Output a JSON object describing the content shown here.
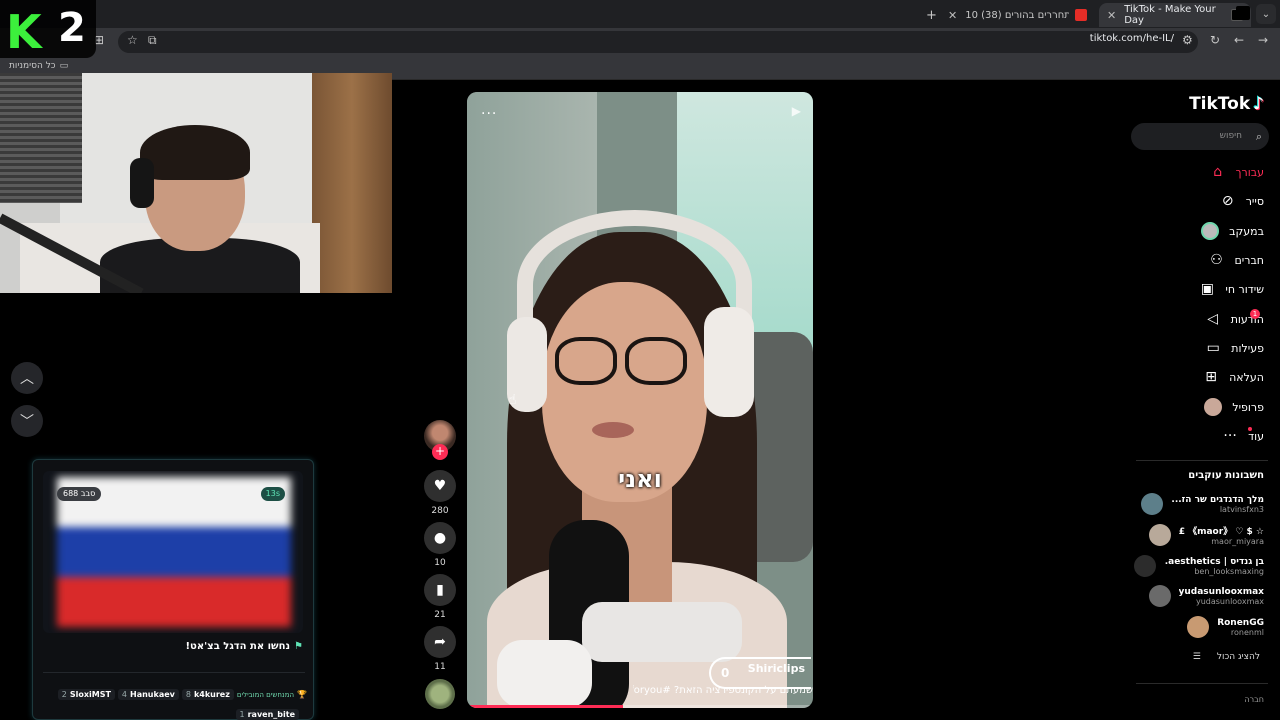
{
  "browser": {
    "tabs": [
      {
        "title": "TikTok - Make Your Day",
        "active": true
      },
      {
        "title": "10 (38) ילדים מתחררים בהורים",
        "active": false
      }
    ],
    "new_tab": "+",
    "url": "tiktok.com/he-IL/",
    "bookmarks_label": "כל הסימניות"
  },
  "overlay": {
    "logo_k": "K",
    "logo_2": "2"
  },
  "flag_widget": {
    "round_label": "סבב 688",
    "timer": "13s",
    "flag_colors": [
      "#f2f2f2",
      "#1d3fa8",
      "#d92a2a"
    ],
    "prompt": "נחשו את הדגל בצ'אט!",
    "top_label": "המנחשים המובילים",
    "top_guessers": [
      {
        "name": "k4kurez",
        "count": "8"
      },
      {
        "name": "Hanukaev",
        "count": "4"
      },
      {
        "name": "SloxiMST",
        "count": "2"
      }
    ],
    "extra_guesser": {
      "name": "raven_bite",
      "count": "1"
    }
  },
  "video": {
    "menu": "...",
    "caption": "ואני",
    "author": "Shiriclips",
    "counter": "0",
    "description": "שמעתם על הקונספירציה הזאת? #foryou",
    "progress": 0.45
  },
  "actions": {
    "likes": "280",
    "comments": "10",
    "saves": "21",
    "shares": "11"
  },
  "sidebar": {
    "brand": "TikTok",
    "search_placeholder": "חיפוש",
    "nav": [
      {
        "label": "עבורך",
        "icon": "home-icon",
        "active": true
      },
      {
        "label": "סייר",
        "icon": "compass-icon"
      },
      {
        "label": "במעקב",
        "icon": "following-icon"
      },
      {
        "label": "חברים",
        "icon": "friends-icon"
      },
      {
        "label": "שידור חי",
        "icon": "live-icon"
      },
      {
        "label": "הודעות",
        "icon": "messages-icon",
        "badge": "1"
      },
      {
        "label": "פעילות",
        "icon": "activity-icon"
      },
      {
        "label": "העלאה",
        "icon": "upload-icon"
      },
      {
        "label": "פרופיל",
        "icon": "profile-icon"
      },
      {
        "label": "עוד",
        "icon": "more-icon"
      }
    ],
    "following_title": "חשבונות עוקבים",
    "accounts": [
      {
        "name": "מלך הדגדגים שר הז...",
        "user": "latvinsfxn3",
        "color": "#5d7f8a"
      },
      {
        "name": "☆ $ ♡ 《maor》 £",
        "user": "maor_miyara",
        "color": "#b8a99a"
      },
      {
        "name": "בן גנדיס | aesthetics...",
        "user": "ben_looksmaxing",
        "color": "#2c2c2c"
      },
      {
        "name": "yudasunlooxmax",
        "user": "yudasunlooxmax",
        "color": "#6a6a6a"
      },
      {
        "name": "RonenGG",
        "user": "ronenml",
        "color": "#c89a72"
      }
    ],
    "show_all": "להציג הכול",
    "company": "חברה"
  }
}
